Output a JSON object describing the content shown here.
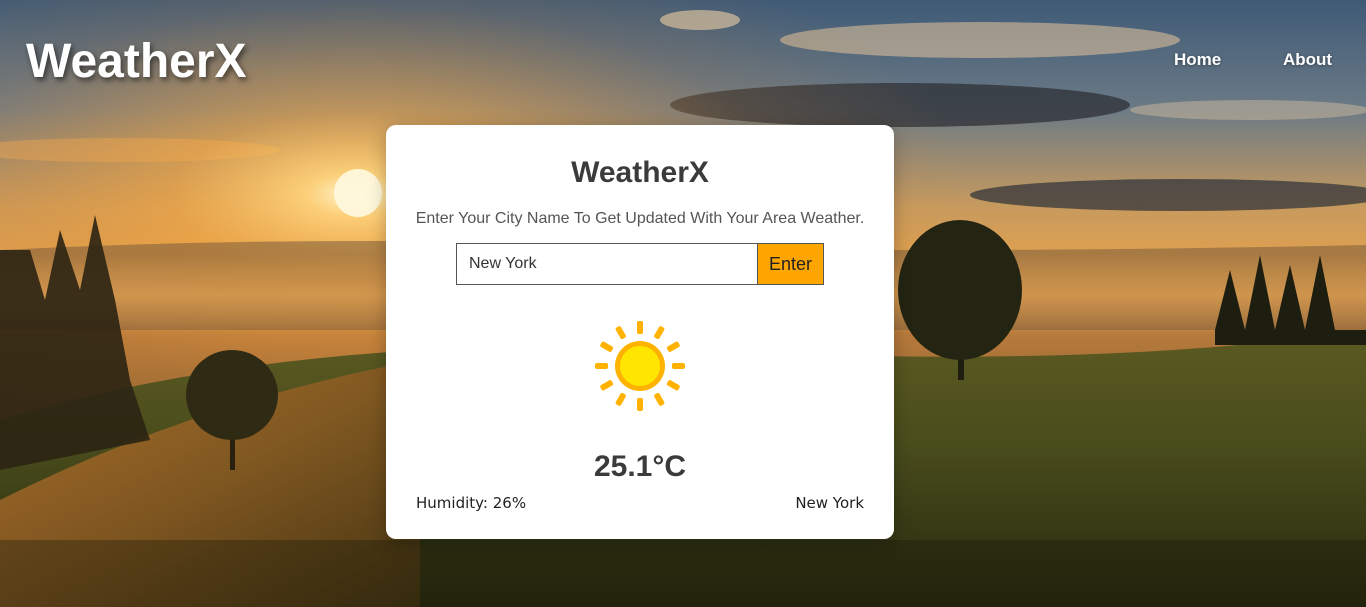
{
  "header": {
    "brand": "WeatherX",
    "nav": [
      {
        "label": "Home"
      },
      {
        "label": "About"
      }
    ]
  },
  "card": {
    "title": "WeatherX",
    "subtitle": "Enter Your City Name To Get Updated With Your Area Weather.",
    "search": {
      "value": "New York",
      "button_label": "Enter"
    },
    "weather_icon": "sun-icon",
    "temperature": "25.1°C",
    "humidity": "Humidity: 26%",
    "city": "New York"
  },
  "colors": {
    "accent": "#ffa500",
    "card_background": "#ffffff",
    "heading_text": "#3b3b3b",
    "sun_core": "#ffe600",
    "sun_rays": "#ffb300"
  }
}
